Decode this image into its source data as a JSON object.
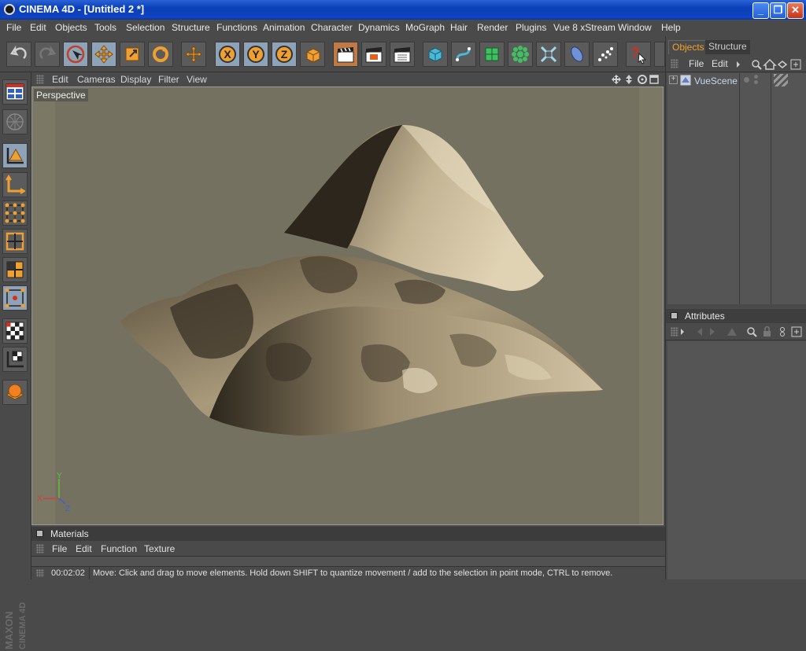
{
  "window": {
    "title": "CINEMA 4D - [Untitled 2 *]"
  },
  "menu": [
    "File",
    "Edit",
    "Objects",
    "Tools",
    "Selection",
    "Structure",
    "Functions",
    "Animation",
    "Character",
    "Dynamics",
    "MoGraph",
    "Hair",
    "Render",
    "Plugins",
    "Vue 8 xStream",
    "Window",
    "Help"
  ],
  "viewport": {
    "menu": [
      "Edit",
      "Cameras",
      "Display",
      "Filter",
      "View"
    ],
    "camera_label": "Perspective",
    "axis": {
      "x": "X",
      "y": "Y",
      "z": "Z"
    }
  },
  "objects_panel": {
    "tabs": [
      "Objects",
      "Structure"
    ],
    "menu": [
      "File",
      "Edit"
    ],
    "items": [
      {
        "name": "VueScene"
      }
    ]
  },
  "attributes_panel": {
    "title": "Attributes"
  },
  "materials_panel": {
    "title": "Materials",
    "menu": [
      "File",
      "Edit",
      "Function",
      "Texture"
    ]
  },
  "status": {
    "time": "00:02:02",
    "message": "Move: Click and drag to move elements. Hold down SHIFT to quantize movement / add to the selection in point mode, CTRL to remove."
  },
  "branding": {
    "vertical_logo": "MAXON CINEMA 4D"
  },
  "colors": {
    "accent": "#e8a040",
    "viewport_bg": "#7b7866",
    "title_bar": "#0a3fb8"
  }
}
